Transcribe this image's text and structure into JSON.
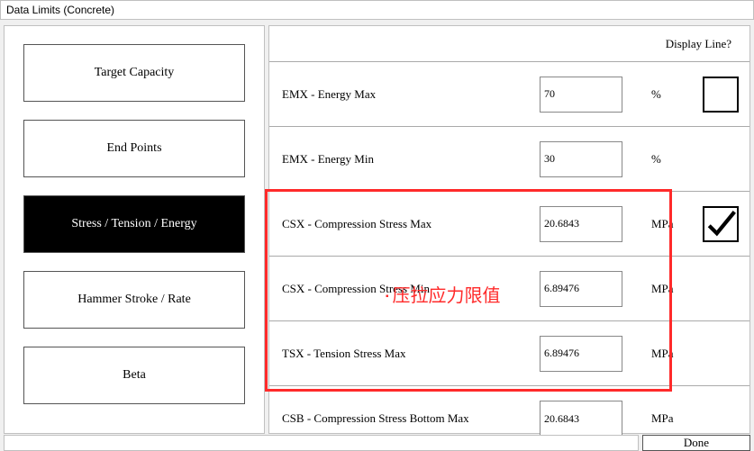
{
  "window": {
    "title": "Data Limits (Concrete)"
  },
  "sidebar": {
    "items": [
      {
        "label": "Target Capacity",
        "selected": false
      },
      {
        "label": "End Points",
        "selected": false
      },
      {
        "label": "Stress / Tension / Energy",
        "selected": true
      },
      {
        "label": "Hammer Stroke / Rate",
        "selected": false
      },
      {
        "label": "Beta",
        "selected": false
      }
    ]
  },
  "main": {
    "header": "Display Line?",
    "rows": [
      {
        "label": "EMX - Energy Max",
        "value": "70",
        "unit": "%",
        "checkbox": true,
        "checked": false
      },
      {
        "label": "EMX - Energy Min",
        "value": "30",
        "unit": "%",
        "checkbox": false
      },
      {
        "label": "CSX - Compression Stress Max",
        "value": "20.6843",
        "unit": "MPa",
        "checkbox": true,
        "checked": true
      },
      {
        "label": "CSX - Compression Stress Min",
        "value": "6.89476",
        "unit": "MPa",
        "checkbox": false
      },
      {
        "label": "TSX - Tension Stress Max",
        "value": "6.89476",
        "unit": "MPa",
        "checkbox": false
      },
      {
        "label": "CSB - Compression Stress Bottom Max",
        "value": "20.6843",
        "unit": "MPa",
        "checkbox": false
      }
    ]
  },
  "footer": {
    "done": "Done"
  },
  "annotation": {
    "text": "压拉应力限值"
  }
}
